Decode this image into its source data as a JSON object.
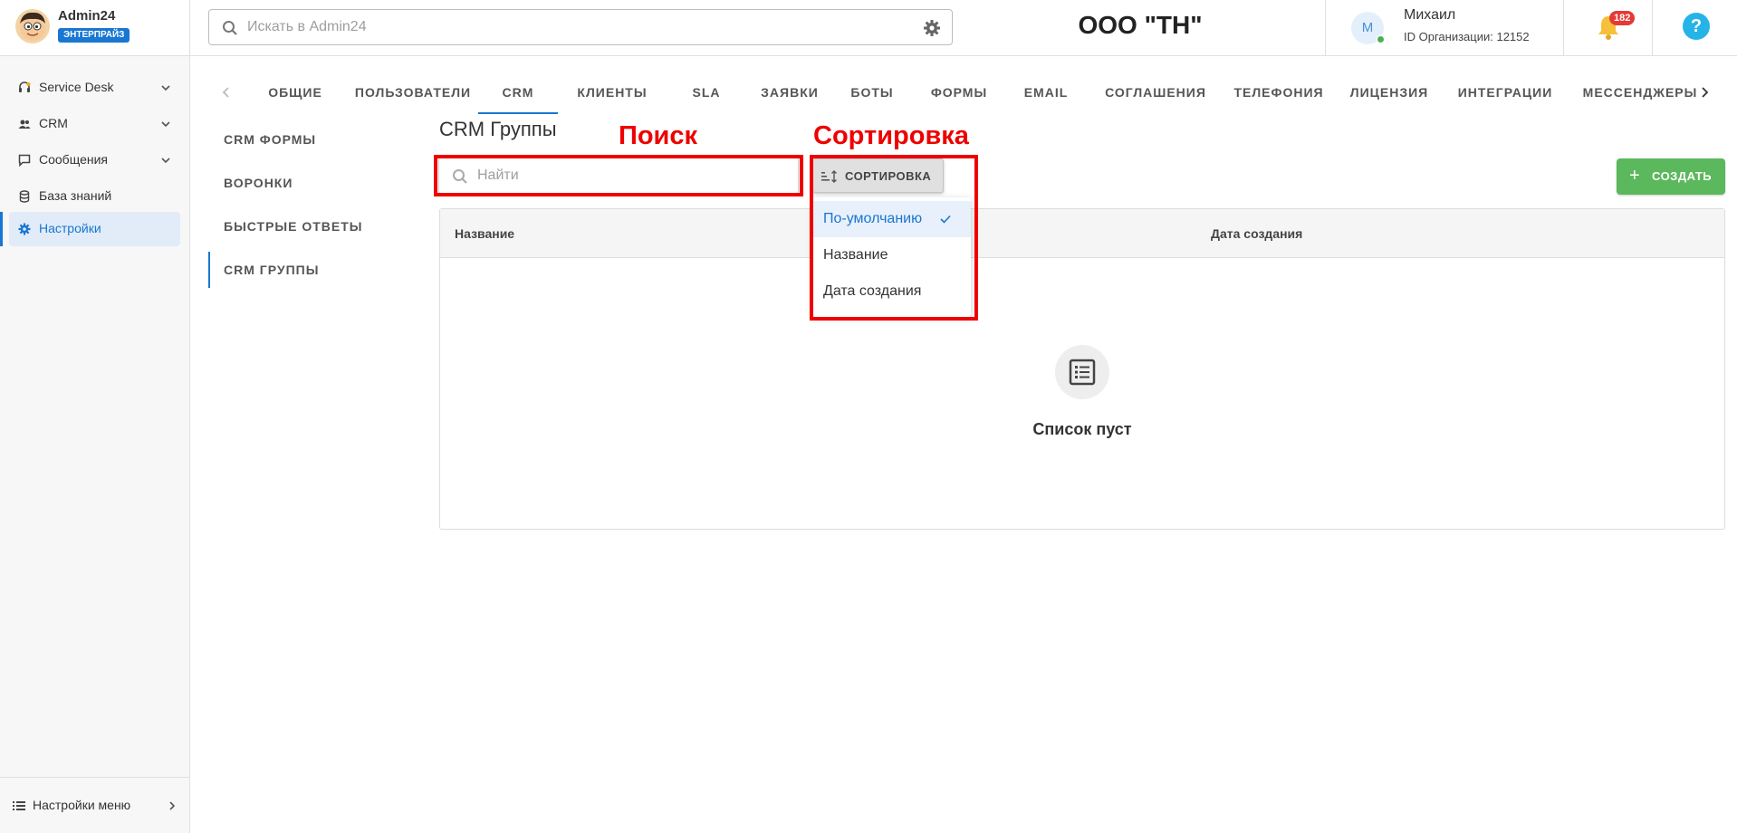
{
  "brand": {
    "name": "Admin24",
    "badge": "ЭНТЕРПРАЙЗ"
  },
  "header": {
    "search_placeholder": "Искать в Admin24",
    "org_name": "ООО \"ТН\"",
    "user_initial": "М",
    "user_name": "Михаил",
    "org_id": "ID Организации: 12152",
    "notifications": "182",
    "help": "?"
  },
  "sidebar": {
    "items": [
      {
        "label": "Service Desk",
        "icon": "headset-icon"
      },
      {
        "label": "CRM",
        "icon": "people-icon"
      },
      {
        "label": "Сообщения",
        "icon": "chat-icon"
      },
      {
        "label": "База знаний",
        "icon": "database-icon"
      },
      {
        "label": "Настройки",
        "icon": "gear-icon",
        "active": true
      }
    ],
    "bottom_label": "Настройки меню"
  },
  "tabs": [
    "ОБЩИЕ",
    "ПОЛЬЗОВАТЕЛИ",
    "CRM",
    "КЛИЕНТЫ",
    "SLA",
    "ЗАЯВКИ",
    "БОТЫ",
    "ФОРМЫ",
    "EMAIL",
    "СОГЛАШЕНИЯ",
    "ТЕЛЕФОНИЯ",
    "ЛИЦЕНЗИЯ",
    "ИНТЕГРАЦИИ",
    "МЕССЕНДЖЕРЫ"
  ],
  "active_tab": "CRM",
  "subnav": [
    "CRM ФОРМЫ",
    "ВОРОНКИ",
    "БЫСТРЫЕ ОТВЕТЫ",
    "CRM ГРУППЫ"
  ],
  "active_subnav": "CRM ГРУППЫ",
  "content": {
    "title": "CRM Группы",
    "annotation_search": "Поиск",
    "annotation_sort": "Сортировка",
    "find_placeholder": "Найти",
    "sort_label": "СОРТИРОВКА",
    "create_label": "СОЗДАТЬ",
    "create_plus": "+",
    "columns": [
      "Название",
      "Дата создания"
    ],
    "empty_text": "Список пуст"
  },
  "sort_menu": {
    "options": [
      "По-умолчанию",
      "Название",
      "Дата создания"
    ],
    "selected": "По-умолчанию"
  },
  "colors": {
    "accent": "#1976d2",
    "create": "#5cb85c",
    "annotation": "#ee0000",
    "badge": "#e53935"
  }
}
